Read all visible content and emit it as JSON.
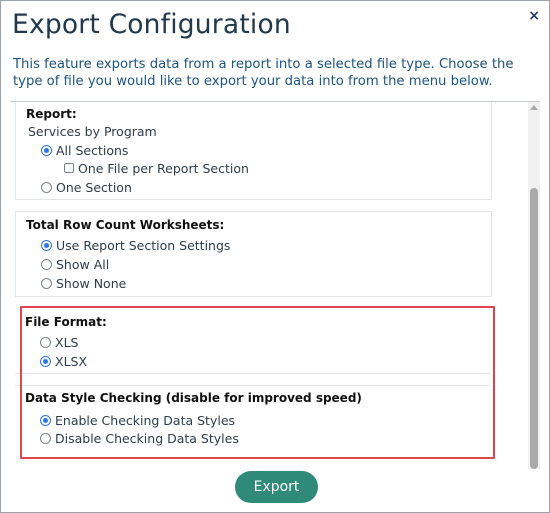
{
  "dialog": {
    "title": "Export Configuration",
    "close_icon": "×",
    "description": "This feature exports data from a report into a selected file type. Choose the type of file you would like to export your data into from the menu below."
  },
  "report": {
    "heading": "Report:",
    "name": "Services by Program",
    "options": [
      {
        "label": "All Sections",
        "selected": true
      },
      {
        "label": "One Section",
        "selected": false
      }
    ],
    "checkbox": {
      "label": "One File per Report Section",
      "checked": false
    }
  },
  "row_count": {
    "heading": "Total Row Count Worksheets:",
    "options": [
      {
        "label": "Use Report Section Settings",
        "selected": true
      },
      {
        "label": "Show All",
        "selected": false
      },
      {
        "label": "Show None",
        "selected": false
      }
    ]
  },
  "file_format": {
    "heading": "File Format:",
    "options": [
      {
        "label": "XLS",
        "selected": false
      },
      {
        "label": "XLSX",
        "selected": true
      }
    ]
  },
  "style_checking": {
    "heading": "Data Style Checking (disable for improved speed)",
    "options": [
      {
        "label": "Enable Checking Data Styles",
        "selected": true
      },
      {
        "label": "Disable Checking Data Styles",
        "selected": false
      }
    ]
  },
  "footer": {
    "export_label": "Export"
  },
  "colors": {
    "accent": "#2f8a79",
    "highlight": "#e0464f",
    "radio": "#2b78e4"
  }
}
